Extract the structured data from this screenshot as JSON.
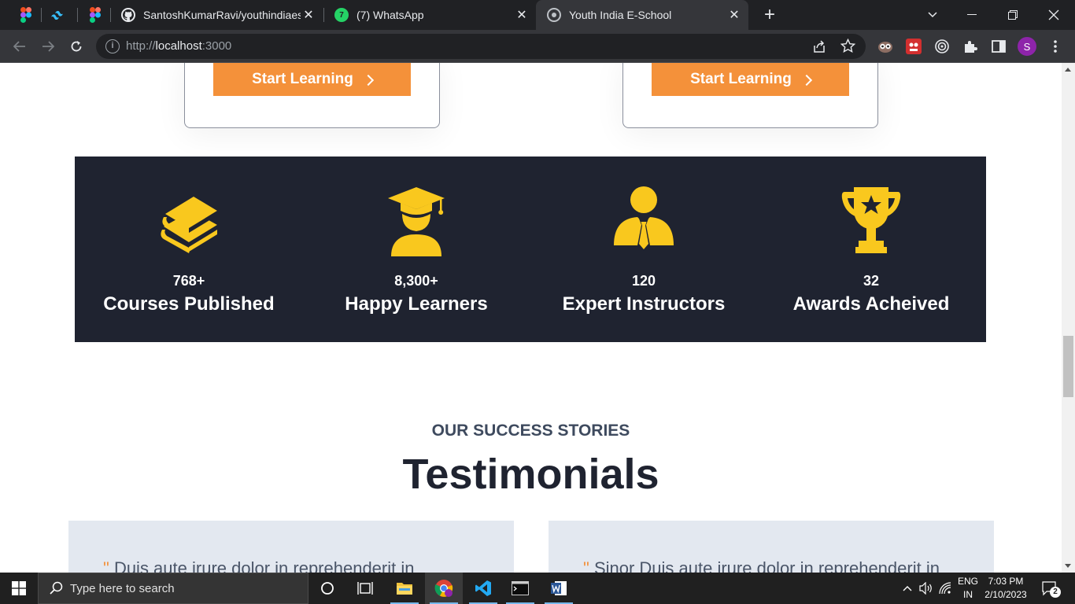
{
  "browser": {
    "tabs": [
      {
        "title": "SantoshKumarRavi/youthindiaesc",
        "icon": "github-icon",
        "active": false
      },
      {
        "title": "(7) WhatsApp",
        "icon": "whatsapp-icon",
        "active": false,
        "badge": "7"
      },
      {
        "title": "Youth India E-School",
        "icon": "site-icon",
        "active": true
      }
    ],
    "url_scheme": "http://",
    "url_host": "localhost",
    "url_rest": ":3000",
    "profile_initial": "S"
  },
  "courses": {
    "button_label": "Start Learning"
  },
  "stats": [
    {
      "icon": "books-icon",
      "number": "768+",
      "label": "Courses Published"
    },
    {
      "icon": "graduate-icon",
      "number": "8,300+",
      "label": "Happy Learners"
    },
    {
      "icon": "instructor-icon",
      "number": "120",
      "label": "Expert Instructors"
    },
    {
      "icon": "trophy-icon",
      "number": "32",
      "label": "Awards Acheived"
    }
  ],
  "testimonials": {
    "eyebrow": "OUR SUCCESS STORIES",
    "title": "Testimonials",
    "quote_mark": "\"",
    "cards": [
      {
        "text": "Duis aute irure dolor in reprehenderit in"
      },
      {
        "text": "Sinor Duis aute irure dolor in reprehenderit in"
      }
    ]
  },
  "taskbar": {
    "search_placeholder": "Type here to search",
    "lang_top": "ENG",
    "lang_bottom": "IN",
    "time": "7:03 PM",
    "date": "2/10/2023",
    "notification_count": "2"
  },
  "colors": {
    "accent_orange": "#f4913a",
    "stats_bg": "#1f2330",
    "icon_yellow": "#f9c81e",
    "card_bg": "#e3e8f0"
  }
}
